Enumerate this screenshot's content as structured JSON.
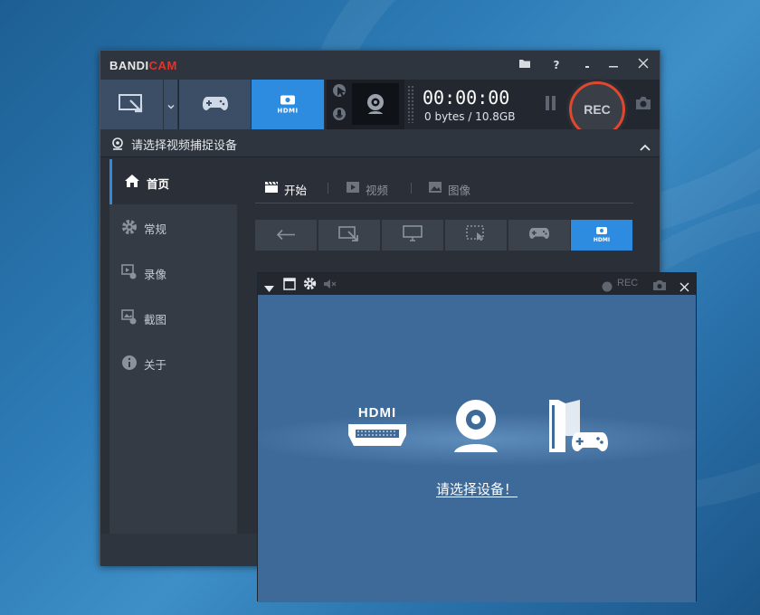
{
  "app": {
    "logo_a": "BANDI",
    "logo_b": "CAM"
  },
  "toolbar": {
    "hdmi_label": "HDMI",
    "timer": "00:00:00",
    "size": "0 bytes / 10.8GB",
    "rec_label": "REC",
    "question_label": "?"
  },
  "header": {
    "title": "请选择视频捕捉设备"
  },
  "sidebar": {
    "items": [
      {
        "label": "首页",
        "icon": "home-icon"
      },
      {
        "label": "常规",
        "icon": "gear-icon"
      },
      {
        "label": "录像",
        "icon": "video-icon"
      },
      {
        "label": "截图",
        "icon": "image-icon"
      },
      {
        "label": "关于",
        "icon": "info-icon"
      }
    ]
  },
  "tabs": [
    {
      "label": "开始"
    },
    {
      "label": "视频"
    },
    {
      "label": "图像"
    }
  ],
  "overlay": {
    "rec_label": "REC",
    "hdmi_label": "HDMI",
    "select_text": "请选择设备！"
  },
  "colors": {
    "accent": "#2e8ce0",
    "rec": "#e0472e",
    "logo_cam": "#e0342c"
  }
}
